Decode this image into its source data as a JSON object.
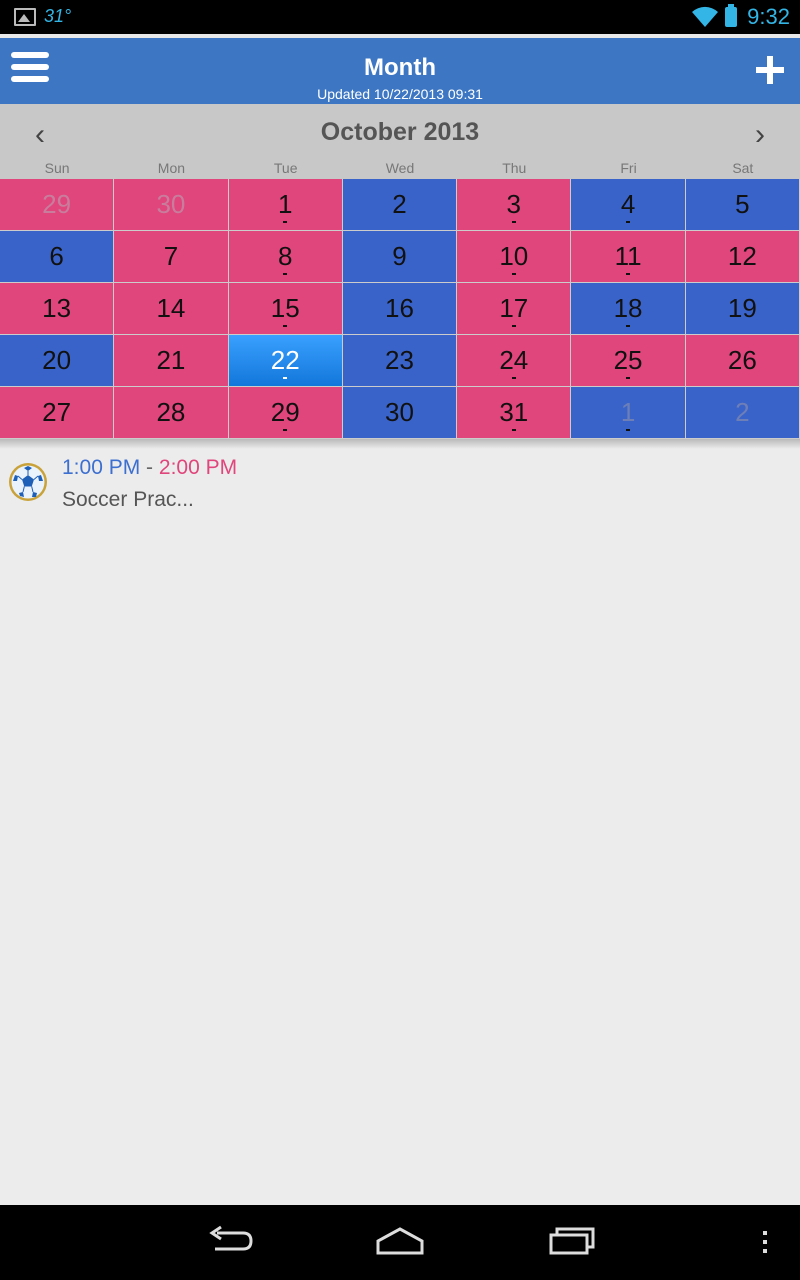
{
  "status": {
    "temperature": "31°",
    "time": "9:32",
    "colors": {
      "accent": "#33b5e5"
    }
  },
  "header": {
    "title": "Month",
    "updated": "Updated 10/22/2013 09:31",
    "menu_icon": "hamburger-menu-icon",
    "add_icon": "plus-icon"
  },
  "calendar": {
    "month_label": "October 2013",
    "prev_label": "‹",
    "next_label": "›",
    "weekdays": [
      "Sun",
      "Mon",
      "Tue",
      "Wed",
      "Thu",
      "Fri",
      "Sat"
    ],
    "colors": {
      "pink": "#e0457b",
      "blue": "#3a63c9",
      "selected": "#1f8ef0"
    },
    "days": [
      {
        "n": "29",
        "c": "pink",
        "other": true,
        "dot": false
      },
      {
        "n": "30",
        "c": "pink",
        "other": true,
        "dot": false
      },
      {
        "n": "1",
        "c": "pink",
        "dot": true
      },
      {
        "n": "2",
        "c": "blue",
        "dot": false
      },
      {
        "n": "3",
        "c": "pink",
        "dot": true
      },
      {
        "n": "4",
        "c": "blue",
        "dot": true
      },
      {
        "n": "5",
        "c": "blue",
        "dot": false
      },
      {
        "n": "6",
        "c": "blue",
        "dot": false
      },
      {
        "n": "7",
        "c": "pink",
        "dot": false
      },
      {
        "n": "8",
        "c": "pink",
        "dot": true
      },
      {
        "n": "9",
        "c": "blue",
        "dot": false
      },
      {
        "n": "10",
        "c": "pink",
        "dot": true
      },
      {
        "n": "11",
        "c": "pink",
        "dot": true
      },
      {
        "n": "12",
        "c": "pink",
        "dot": false
      },
      {
        "n": "13",
        "c": "pink",
        "dot": false
      },
      {
        "n": "14",
        "c": "pink",
        "dot": false
      },
      {
        "n": "15",
        "c": "pink",
        "dot": true
      },
      {
        "n": "16",
        "c": "blue",
        "dot": false
      },
      {
        "n": "17",
        "c": "pink",
        "dot": true
      },
      {
        "n": "18",
        "c": "blue",
        "dot": true
      },
      {
        "n": "19",
        "c": "blue",
        "dot": false
      },
      {
        "n": "20",
        "c": "blue",
        "dot": false
      },
      {
        "n": "21",
        "c": "pink",
        "dot": false
      },
      {
        "n": "22",
        "c": "pink",
        "selected": true,
        "dot": true
      },
      {
        "n": "23",
        "c": "blue",
        "dot": false
      },
      {
        "n": "24",
        "c": "pink",
        "dot": true
      },
      {
        "n": "25",
        "c": "pink",
        "dot": true
      },
      {
        "n": "26",
        "c": "pink",
        "dot": false
      },
      {
        "n": "27",
        "c": "pink",
        "dot": false
      },
      {
        "n": "28",
        "c": "pink",
        "dot": false
      },
      {
        "n": "29",
        "c": "pink",
        "dot": true
      },
      {
        "n": "30",
        "c": "blue",
        "dot": false
      },
      {
        "n": "31",
        "c": "pink",
        "dot": true
      },
      {
        "n": "1",
        "c": "blue",
        "other": true,
        "dot": true
      },
      {
        "n": "2",
        "c": "blue",
        "other": true,
        "dot": false
      }
    ]
  },
  "events": [
    {
      "start": "1:00 PM",
      "separator": " - ",
      "end": "2:00 PM",
      "title": "Soccer Prac...",
      "icon": "soccer-ball-icon"
    }
  ],
  "navbar": {
    "icons": [
      "back-icon",
      "home-icon",
      "recent-apps-icon",
      "overflow-menu-icon"
    ]
  }
}
